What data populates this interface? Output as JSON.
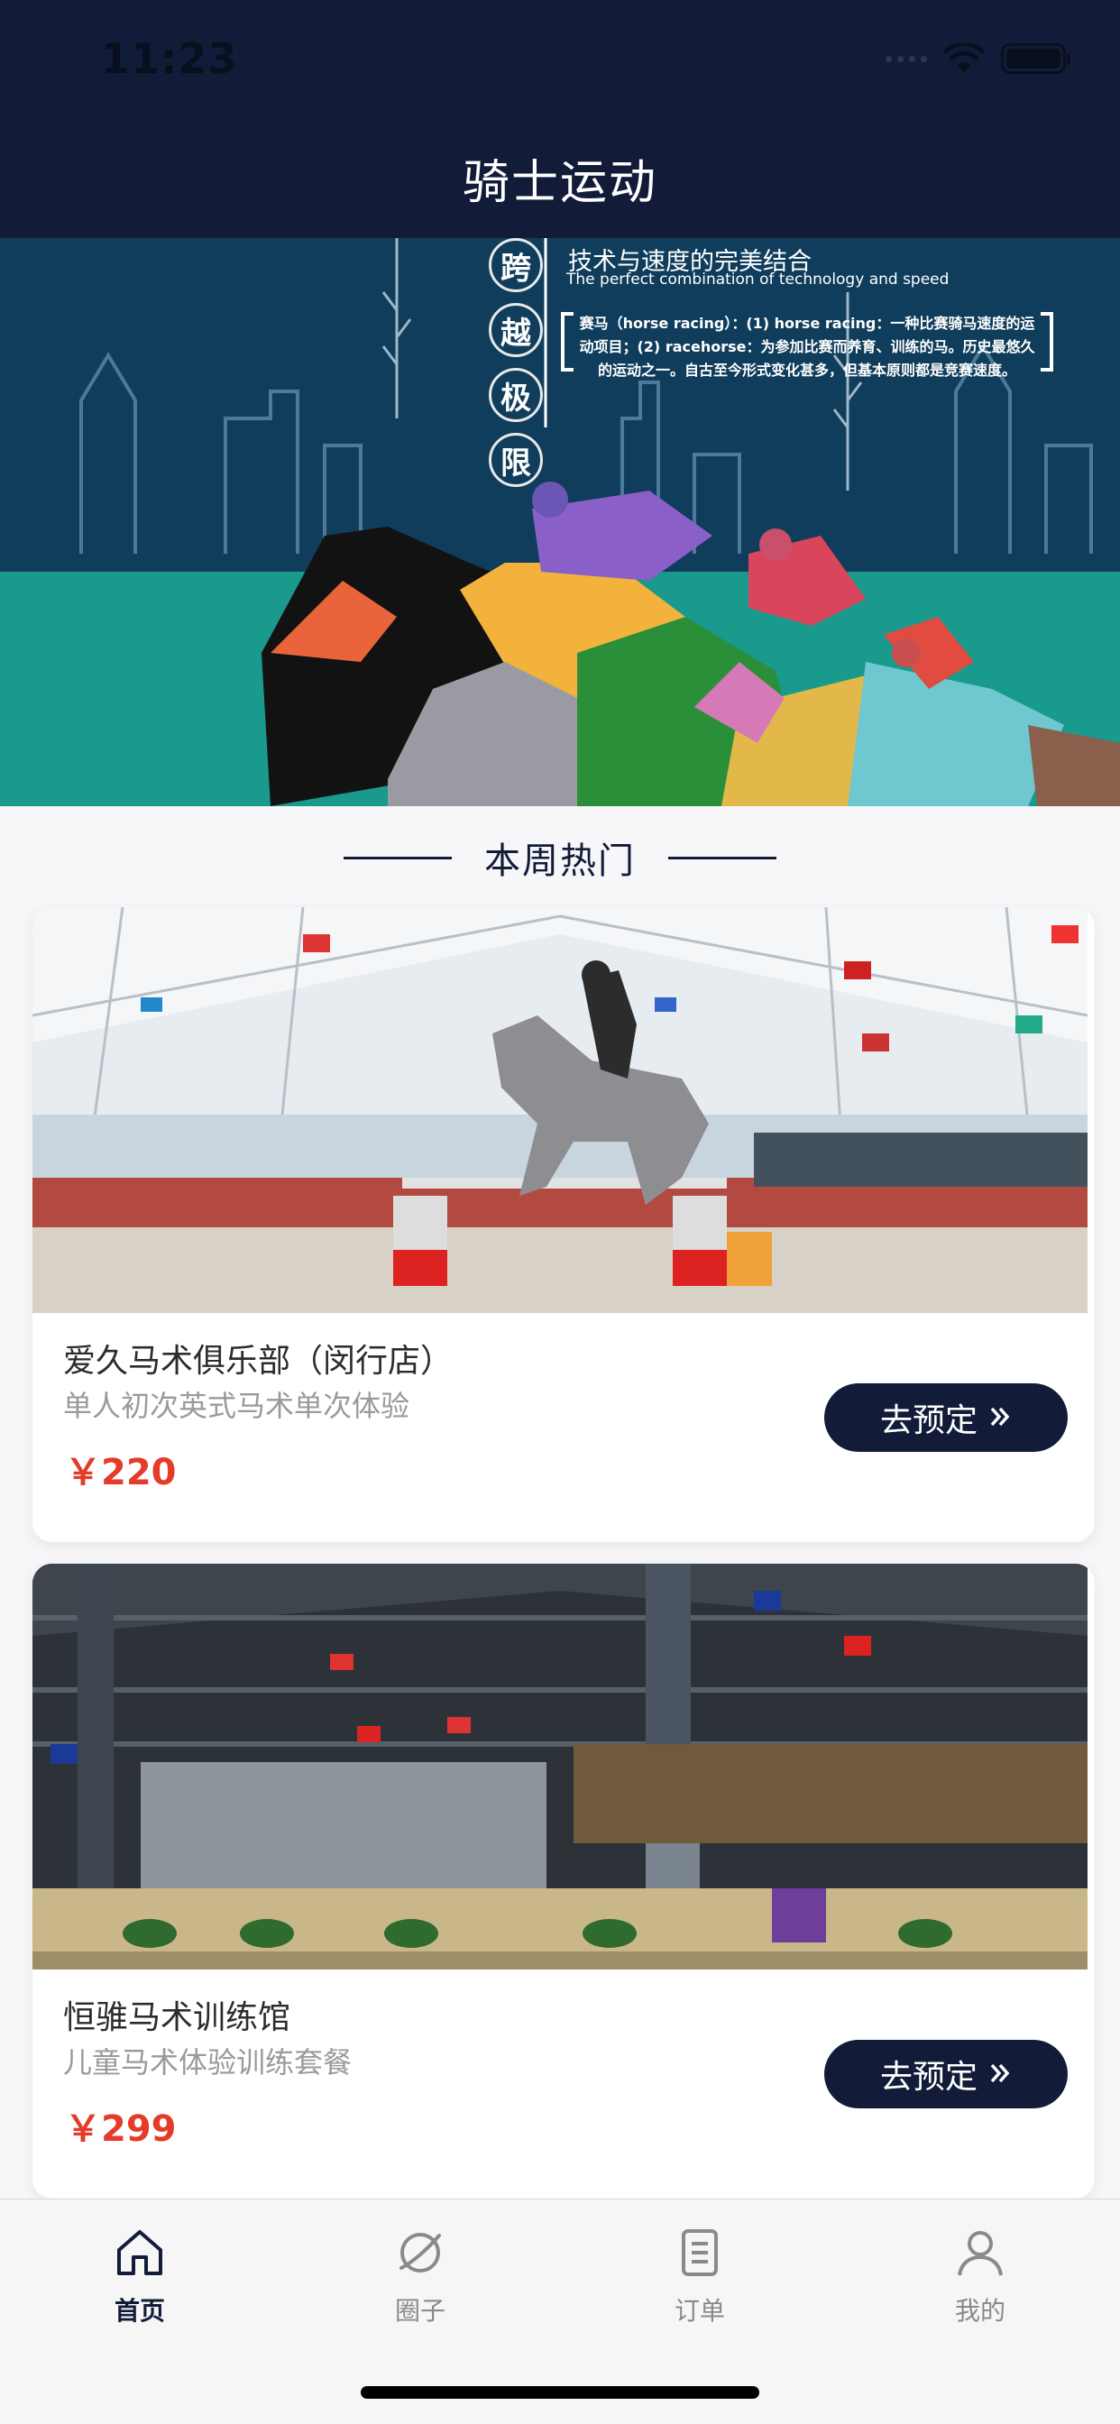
{
  "status_bar": {
    "time": "11:23"
  },
  "header": {
    "title": "骑士运动"
  },
  "banner": {
    "vertical_chars": [
      "跨",
      "越",
      "极",
      "限"
    ],
    "heading": "技术与速度的完美结合",
    "subheading": "The perfect combination of technology and speed",
    "description": "赛马（horse racing）：(1) horse racing：一种比赛骑马速度的运动项目；(2) racehorse：为参加比赛而养育、训练的马。历史最悠久的运动之一。自古至今形式变化甚多，但基本原则都是竞赛速度。"
  },
  "section": {
    "title": "本周热门"
  },
  "venues": [
    {
      "name": "爱久马术俱乐部（闵行店）",
      "subtitle": "单人初次英式马术单次体验",
      "price": "￥220",
      "button_label": "去预定",
      "button_icon": "double-chevron-right-icon"
    },
    {
      "name": "恒骓马术训练馆",
      "subtitle": "儿童马术体验训练套餐",
      "price": "￥299",
      "button_label": "去预定",
      "button_icon": "double-chevron-right-icon"
    }
  ],
  "tabbar": {
    "items": [
      {
        "label": "首页",
        "icon": "home-icon",
        "active": true
      },
      {
        "label": "圈子",
        "icon": "planet-icon",
        "active": false
      },
      {
        "label": "订单",
        "icon": "order-list-icon",
        "active": false
      },
      {
        "label": "我的",
        "icon": "user-icon",
        "active": false
      }
    ]
  },
  "colors": {
    "nav_bg": "#121c39",
    "accent_price": "#e53b2a",
    "tab_active": "#121c39",
    "tab_inactive": "#8a8a8e"
  }
}
